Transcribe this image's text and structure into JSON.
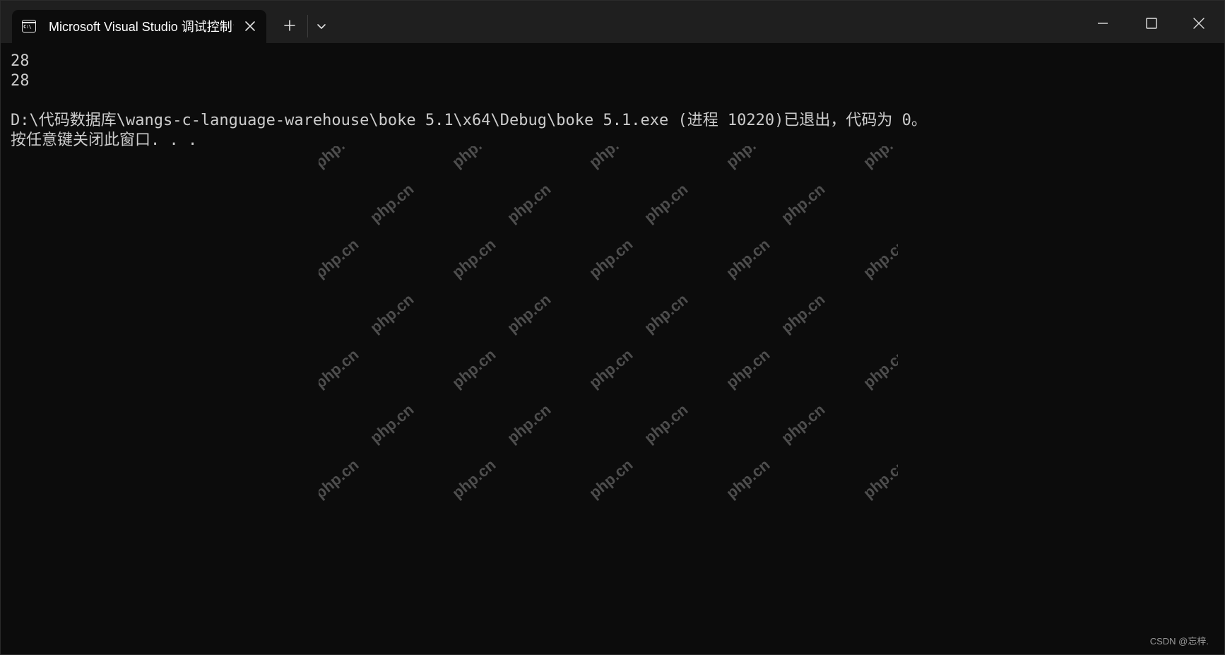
{
  "window": {
    "tab_icon_text": "C:\\",
    "tab_title": "Microsoft Visual Studio 调试控制台",
    "new_tab_symbol": "+",
    "colors": {
      "titlebar_bg": "#1f1f1f",
      "console_bg": "#0c0c0c",
      "console_fg": "#cccccc",
      "watermark": "#4e4e4e"
    },
    "icons": {
      "tab": "console-icon",
      "close_tab": "close-icon",
      "new_tab": "plus-icon",
      "dropdown": "chevron-down-icon",
      "minimize": "minimize-icon",
      "maximize": "maximize-icon",
      "close_window": "close-icon"
    }
  },
  "console": {
    "lines": [
      "28",
      "28",
      "",
      "D:\\代码数据库\\wangs-c-language-warehouse\\boke 5.1\\x64\\Debug\\boke 5.1.exe (进程 10220)已退出，代码为 0。",
      "按任意键关闭此窗口. . ."
    ]
  },
  "watermark": {
    "text": "php.cn"
  },
  "credit": {
    "text": "CSDN @忘梓."
  }
}
